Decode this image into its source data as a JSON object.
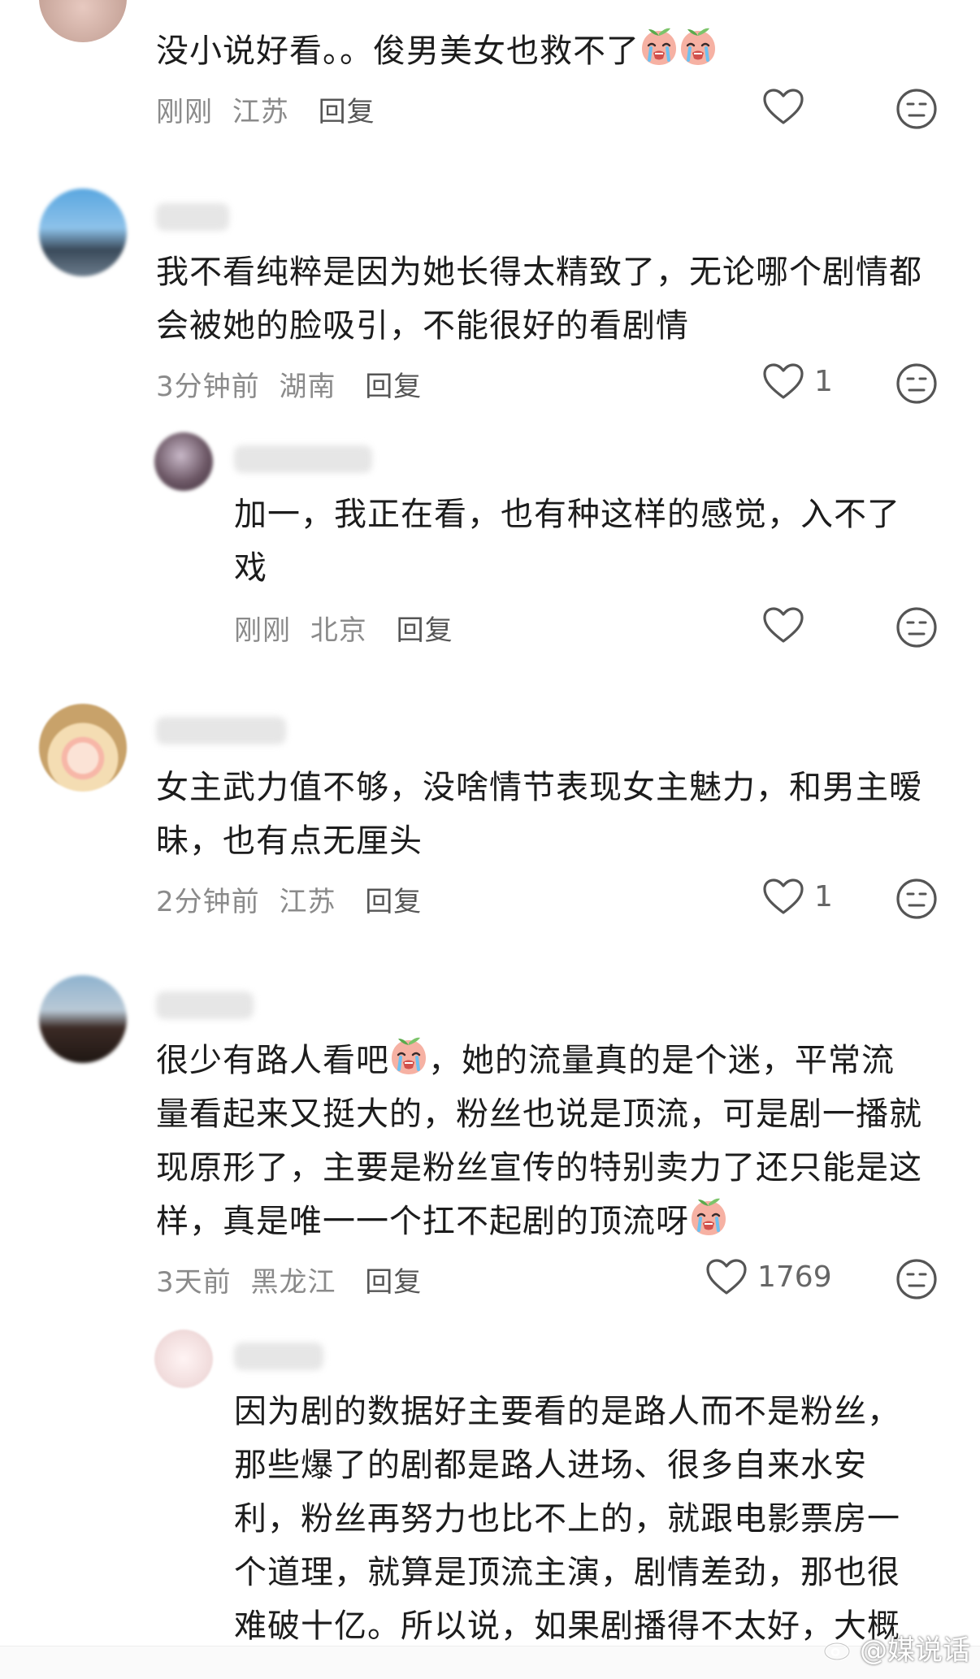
{
  "comments": [
    {
      "text": "没小说好看。。俊男美女也救不了",
      "time": "刚刚",
      "location": "江苏",
      "reply_label": "回复",
      "likes": ""
    },
    {
      "text": "我不看纯粹是因为她长得太精致了，无论哪个剧情都\n会被她的脸吸引，不能很好的看剧情",
      "time": "3分钟前",
      "location": "湖南",
      "reply_label": "回复",
      "likes": "1"
    },
    {
      "text": "加一，我正在看，也有种这样的感觉，入不了\n戏",
      "time": "刚刚",
      "location": "北京",
      "reply_label": "回复",
      "likes": ""
    },
    {
      "text": "女主武力值不够，没啥情节表现女主魅力，和男主暧\n昧，也有点无厘头",
      "time": "2分钟前",
      "location": "江苏",
      "reply_label": "回复",
      "likes": "1"
    },
    {
      "line1a": "很少有路人看吧",
      "line1b": "，她的流量真的是个迷，平常流",
      "line2": "量看起来又挺大的，粉丝也说是顶流，可是剧一播就",
      "line3": "现原形了，主要是粉丝宣传的特别卖力了还只能是这",
      "line4": "样，真是唯一一个扛不起剧的顶流呀",
      "time": "3天前",
      "location": "黑龙江",
      "reply_label": "回复",
      "likes": "1769"
    },
    {
      "text": "因为剧的数据好主要看的是路人而不是粉丝，\n那些爆了的剧都是路人进场、很多自来水安\n利，粉丝再努力也比不上的，就跟电影票房一\n个道理，就算是顶流主演，剧情差劲，那也很\n难破十亿。所以说，如果剧播得不太好，大概"
    }
  ],
  "watermark": "@媒说话",
  "icons": {
    "like": "heart-outline-icon",
    "dislike": "neutral-face-icon",
    "emoji": "crying-peach-emoji",
    "weibo": "weibo-logo-icon"
  }
}
